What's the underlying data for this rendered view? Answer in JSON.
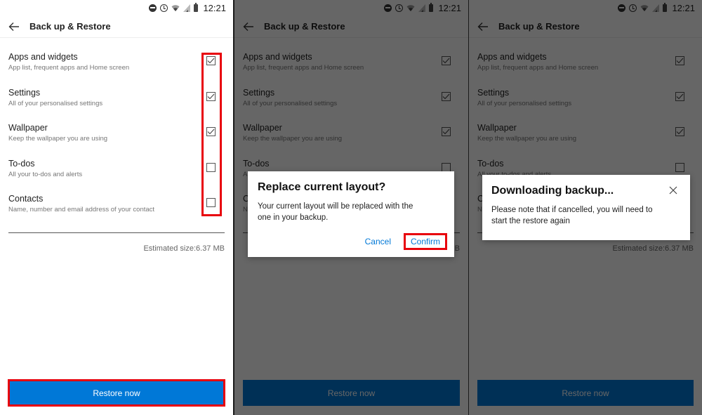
{
  "status_bar": {
    "time": "12:21",
    "icons": [
      "do-not-disturb-icon",
      "alarm-icon",
      "wifi-icon",
      "signal-icon",
      "battery-icon"
    ]
  },
  "app_bar": {
    "title": "Back up & Restore",
    "back_icon": "arrow-left-icon"
  },
  "options": [
    {
      "label": "Apps and widgets",
      "description": "App list, frequent apps and Home screen",
      "checked": true
    },
    {
      "label": "Settings",
      "description": "All of your personalised settings",
      "checked": true
    },
    {
      "label": "Wallpaper",
      "description": "Keep the wallpaper you are using",
      "checked": true
    },
    {
      "label": "To-dos",
      "description": "All your to-dos and alerts",
      "checked": false
    },
    {
      "label": "Contacts",
      "description": "Name, number and email address of your contact",
      "checked": false
    }
  ],
  "estimated_size": "Estimated size:6.37 MB",
  "restore_button": "Restore now",
  "confirm_dialog": {
    "title": "Replace current layout?",
    "body": "Your current layout will be replaced with the one in your backup.",
    "cancel": "Cancel",
    "confirm": "Confirm"
  },
  "download_dialog": {
    "title": "Downloading backup...",
    "body": "Please note that if cancelled, you will need to start the restore again",
    "close_icon": "close-icon"
  },
  "colors": {
    "accent": "#0078d7",
    "highlight": "#e8000b",
    "overlay": "rgba(0,0,0,0.6)"
  }
}
